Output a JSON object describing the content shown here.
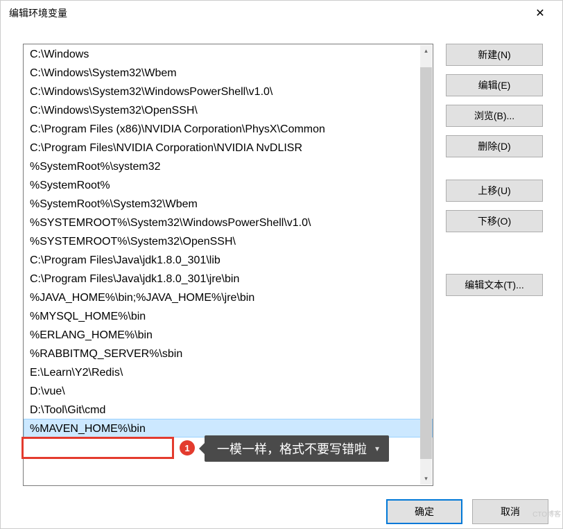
{
  "window": {
    "title": "编辑环境变量",
    "close": "✕"
  },
  "list": {
    "items": [
      "C:\\Windows",
      "C:\\Windows\\System32\\Wbem",
      "C:\\Windows\\System32\\WindowsPowerShell\\v1.0\\",
      "C:\\Windows\\System32\\OpenSSH\\",
      "C:\\Program Files (x86)\\NVIDIA Corporation\\PhysX\\Common",
      "C:\\Program Files\\NVIDIA Corporation\\NVIDIA NvDLISR",
      "%SystemRoot%\\system32",
      "%SystemRoot%",
      "%SystemRoot%\\System32\\Wbem",
      "%SYSTEMROOT%\\System32\\WindowsPowerShell\\v1.0\\",
      "%SYSTEMROOT%\\System32\\OpenSSH\\",
      "C:\\Program Files\\Java\\jdk1.8.0_301\\lib",
      "C:\\Program Files\\Java\\jdk1.8.0_301\\jre\\bin",
      "%JAVA_HOME%\\bin;%JAVA_HOME%\\jre\\bin",
      "%MYSQL_HOME%\\bin",
      "%ERLANG_HOME%\\bin",
      "%RABBITMQ_SERVER%\\sbin",
      "E:\\Learn\\Y2\\Redis\\",
      "D:\\vue\\",
      "D:\\Tool\\Git\\cmd",
      "%MAVEN_HOME%\\bin"
    ],
    "selected_index": 20
  },
  "buttons": {
    "new": "新建(N)",
    "edit": "编辑(E)",
    "browse": "浏览(B)...",
    "delete": "删除(D)",
    "moveup": "上移(U)",
    "movedown": "下移(O)",
    "edittext": "编辑文本(T)...",
    "ok": "确定",
    "cancel": "取消"
  },
  "annotation": {
    "number": "1",
    "tooltip": "一模一样，格式不要写错啦"
  },
  "watermark": "CTO博客"
}
